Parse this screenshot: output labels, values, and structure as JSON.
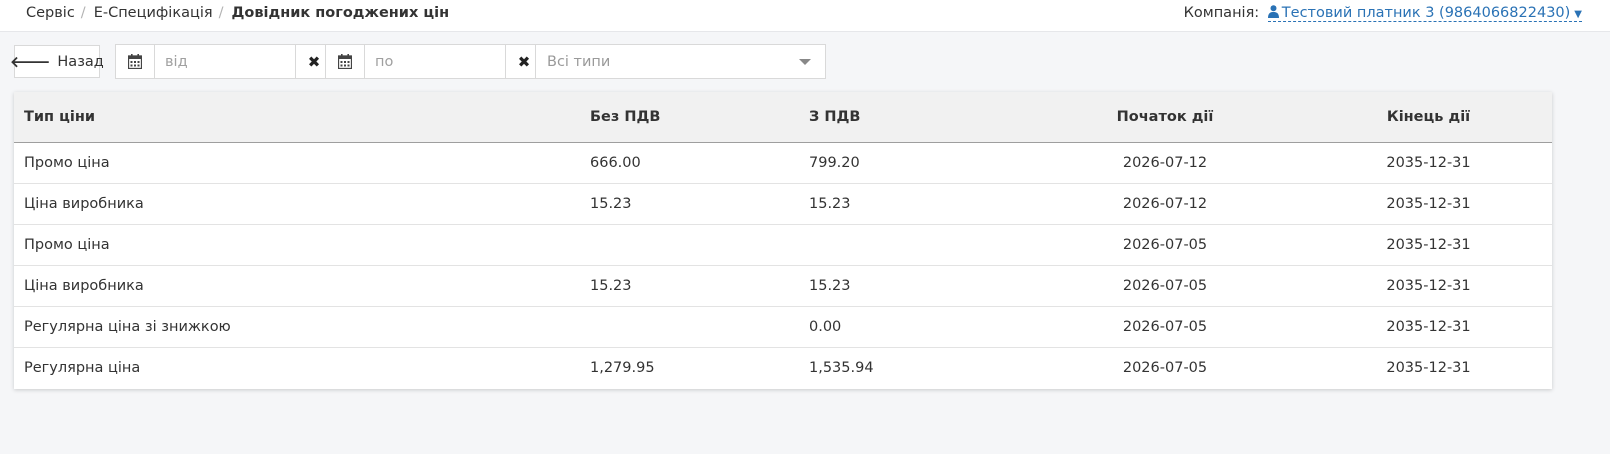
{
  "breadcrumb": {
    "items": [
      "Сервіс",
      "Е-Специфікація"
    ],
    "separator": "/",
    "current": "Довідник погоджених цін"
  },
  "company": {
    "label": "Компанія:",
    "name": "Тестовий платник 3 (9864066822430)",
    "icon": "user-icon",
    "link_color": "#2a72b5"
  },
  "toolbar": {
    "back_label": "Назад",
    "date_from_placeholder": "від",
    "date_to_placeholder": "по",
    "type_select_value": "Всі типи"
  },
  "table": {
    "columns": [
      "Тип ціни",
      "Без ПДВ",
      "З ПДВ",
      "Початок дії",
      "Кінець дії"
    ],
    "rows": [
      [
        "Промо ціна",
        "666.00",
        "799.20",
        "2026-07-12",
        "2035-12-31"
      ],
      [
        "Ціна виробника",
        "15.23",
        "15.23",
        "2026-07-12",
        "2035-12-31"
      ],
      [
        "Промо ціна",
        "",
        "",
        "2026-07-05",
        "2035-12-31"
      ],
      [
        "Ціна виробника",
        "15.23",
        "15.23",
        "2026-07-05",
        "2035-12-31"
      ],
      [
        "Регулярна ціна зі знижкою",
        "",
        "0.00",
        "2026-07-05",
        "2035-12-31"
      ],
      [
        "Регулярна ціна",
        "1,279.95",
        "1,535.94",
        "2026-07-05",
        "2035-12-31"
      ]
    ]
  }
}
